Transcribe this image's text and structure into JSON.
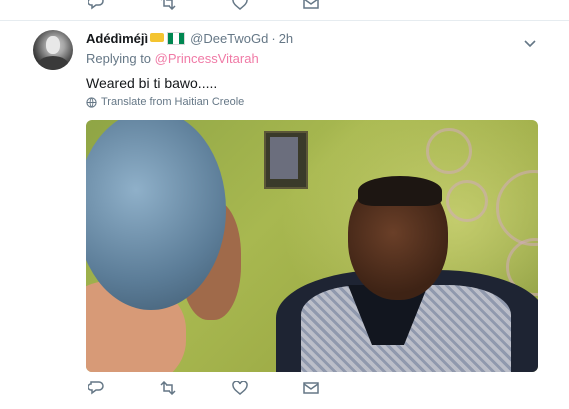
{
  "previous_tweet": {
    "actions": [
      "reply",
      "retweet",
      "like",
      "message"
    ]
  },
  "tweet": {
    "display_name": "Adédìméjì",
    "name_emoji": [
      "crown",
      "nigeria-flag"
    ],
    "handle": "@DeeTwoGd",
    "separator": "·",
    "time": "2h",
    "reply_prefix": "Replying to",
    "reply_to": "@PrincessVitarah",
    "text": "Weared bi ti bawo.....",
    "translate_label": "Translate from Haitian Creole",
    "media": "image-man-grinning",
    "actions": [
      "reply-icon",
      "retweet-icon",
      "like-icon",
      "direct-message-icon"
    ]
  },
  "colors": {
    "link": "#f07aa6",
    "secondary_text": "#657786",
    "icon": "#657786",
    "divider": "#e6ecf0",
    "flag_green": "#008751",
    "flag_white": "#ffffff"
  }
}
